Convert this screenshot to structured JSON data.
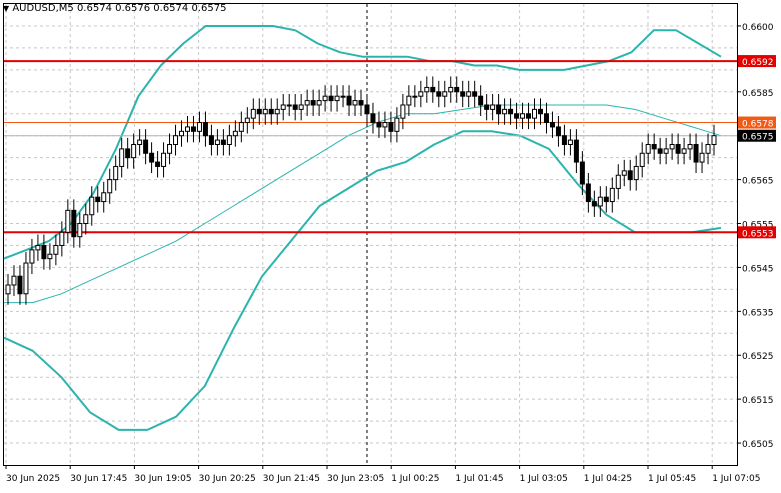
{
  "header": {
    "arrow": "▼",
    "symbol": "AUDUSD,M5",
    "ohlc": "0.6574 0.6576 0.6574 0.6575"
  },
  "chart_data": {
    "type": "candlestick",
    "symbol": "AUDUSD",
    "timeframe": "M5",
    "ylim": [
      0.65,
      0.6605
    ],
    "grid": true,
    "y_ticks": [
      "0.6600",
      "0.6592",
      "0.6585",
      "0.6578",
      "0.6575",
      "0.6565",
      "0.6555",
      "0.6553",
      "0.6545",
      "0.6535",
      "0.6525",
      "0.6515",
      "0.6505"
    ],
    "x_ticks": [
      "30 Jun 2025",
      "30 Jun 17:45",
      "30 Jun 19:05",
      "30 Jun 20:25",
      "30 Jun 21:45",
      "30 Jun 23:05",
      "1 Jul 00:25",
      "1 Jul 01:45",
      "1 Jul 03:05",
      "1 Jul 04:25",
      "1 Jul 05:45",
      "1 Jul 07:05"
    ],
    "levels": [
      {
        "value": 0.6592,
        "label": "0.6592",
        "color": "#e30000",
        "type": "support-resistance"
      },
      {
        "value": 0.6553,
        "label": "0.6553",
        "color": "#e30000",
        "type": "support-resistance"
      },
      {
        "value": 0.6578,
        "label": "0.6578",
        "color": "#f05a14",
        "type": "level"
      },
      {
        "value": 0.6575,
        "label": "0.6575",
        "color": "#000000",
        "type": "current-price"
      }
    ],
    "session_divider_index": 60,
    "bollinger": {
      "color": "#2ab4ad",
      "upper": [
        0.6547,
        0.6549,
        0.6551,
        0.6555,
        0.6562,
        0.6572,
        0.6584,
        0.6591,
        0.6596,
        0.66,
        0.66,
        0.66,
        0.66,
        0.6599,
        0.6596,
        0.6594,
        0.6593,
        0.6593,
        0.6593,
        0.6592,
        0.6592,
        0.6591,
        0.6591,
        0.659,
        0.659,
        0.659,
        0.6591,
        0.6592,
        0.6594,
        0.6599,
        0.6599,
        0.6596,
        0.6593
      ],
      "mid": [
        0.6537,
        0.6537,
        0.6539,
        0.6542,
        0.6545,
        0.6548,
        0.6551,
        0.6555,
        0.6559,
        0.6563,
        0.6567,
        0.6571,
        0.6575,
        0.6578,
        0.658,
        0.658,
        0.6581,
        0.6582,
        0.6582,
        0.6582,
        0.6582,
        0.6582,
        0.6581,
        0.6579,
        0.6577,
        0.6575
      ],
      "lower": [
        0.6529,
        0.6526,
        0.652,
        0.6512,
        0.6508,
        0.6508,
        0.6511,
        0.6518,
        0.6531,
        0.6543,
        0.6551,
        0.6559,
        0.6563,
        0.6567,
        0.6569,
        0.6573,
        0.6576,
        0.6576,
        0.6575,
        0.6572,
        0.6564,
        0.6557,
        0.6553,
        0.6553,
        0.6553,
        0.6554
      ]
    },
    "closes": [
      0.6541,
      0.6543,
      0.6539,
      0.6546,
      0.6549,
      0.655,
      0.6547,
      0.6548,
      0.655,
      0.6553,
      0.6558,
      0.6552,
      0.6555,
      0.6557,
      0.6561,
      0.656,
      0.6562,
      0.6565,
      0.6568,
      0.6572,
      0.657,
      0.6573,
      0.6574,
      0.6571,
      0.6569,
      0.6568,
      0.6571,
      0.6573,
      0.6575,
      0.6576,
      0.6577,
      0.6576,
      0.6578,
      0.6575,
      0.6573,
      0.6574,
      0.6573,
      0.6575,
      0.6576,
      0.6578,
      0.6579,
      0.6581,
      0.658,
      0.6581,
      0.658,
      0.6581,
      0.6582,
      0.6582,
      0.6581,
      0.6582,
      0.6583,
      0.6582,
      0.6583,
      0.6584,
      0.6583,
      0.6584,
      0.6584,
      0.6582,
      0.6583,
      0.6582,
      0.658,
      0.6578,
      0.6577,
      0.6578,
      0.6576,
      0.6579,
      0.6582,
      0.6584,
      0.6584,
      0.6585,
      0.6586,
      0.6585,
      0.6584,
      0.6585,
      0.6586,
      0.6585,
      0.6584,
      0.6585,
      0.6584,
      0.6582,
      0.6581,
      0.6582,
      0.658,
      0.6581,
      0.658,
      0.6579,
      0.658,
      0.6579,
      0.6581,
      0.658,
      0.6578,
      0.6577,
      0.6575,
      0.6573,
      0.6574,
      0.6569,
      0.6564,
      0.656,
      0.6559,
      0.6561,
      0.656,
      0.6563,
      0.6566,
      0.6567,
      0.6565,
      0.6568,
      0.6571,
      0.6573,
      0.6572,
      0.6571,
      0.6572,
      0.6573,
      0.6571,
      0.6572,
      0.6573,
      0.6569,
      0.6571,
      0.6573,
      0.6575
    ]
  }
}
